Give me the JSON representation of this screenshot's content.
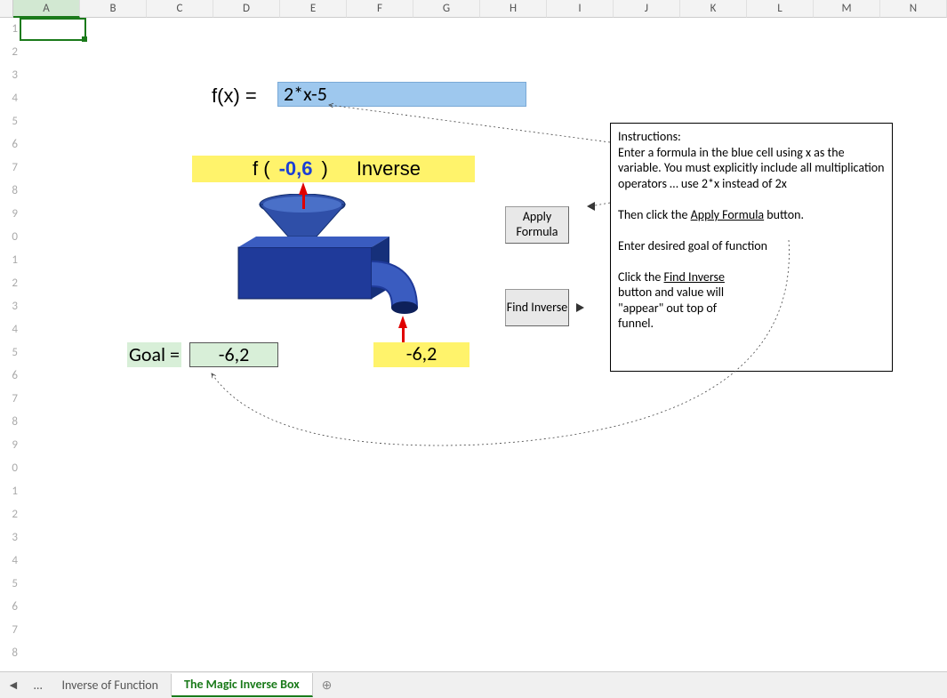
{
  "columns": [
    "A",
    "B",
    "C",
    "D",
    "E",
    "F",
    "G",
    "H",
    "I",
    "J",
    "K",
    "L",
    "M",
    "N"
  ],
  "rows_visible": 29,
  "fx": {
    "label": "f(x) = ",
    "formula": "2*x-5"
  },
  "yellow_bar": {
    "f_open": "f (",
    "value": "-0,6",
    "f_close": ")",
    "inv_label": "Inverse"
  },
  "goal": {
    "label": "Goal =",
    "value": "-6,2"
  },
  "output": {
    "value": "-6,2"
  },
  "buttons": {
    "apply": "Apply Formula",
    "find": "Find Inverse"
  },
  "instructions": {
    "title": "Instructions:",
    "p1a": "Enter a formula in the blue cell using x as the variable.  You must explicitly include all multiplication operators … use 2*x  instead of 2x",
    "p2a": "Then click the ",
    "p2u": "Apply Formula",
    "p2b": " button.",
    "p3": "Enter desired goal of function",
    "p4a": "Click the ",
    "p4u": "Find Inverse",
    "p5": " button and value will \"appear\" out top of funnel."
  },
  "tabs": {
    "nav_prev": "◄",
    "nav_more": "…",
    "t1": "Inverse of Function",
    "t2": "The Magic Inverse Box",
    "add": "⊕"
  }
}
